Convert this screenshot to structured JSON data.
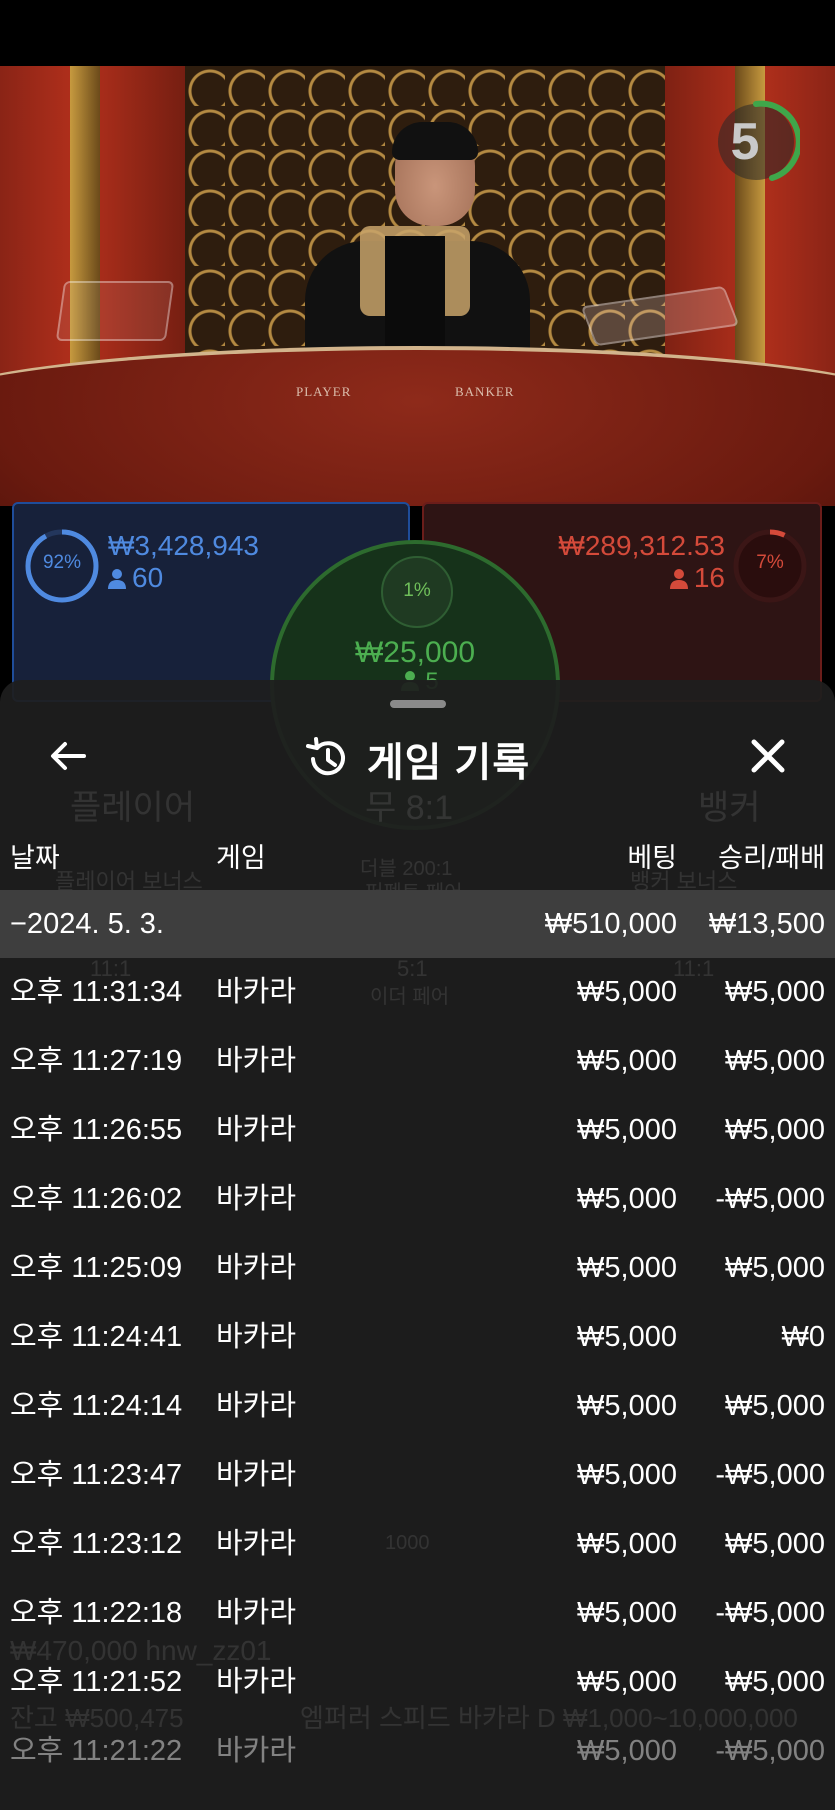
{
  "video": {
    "felt_labels": [
      "PLAYER",
      "BANKER"
    ],
    "timer": "5"
  },
  "bets": {
    "player": {
      "percent": "92%",
      "amount": "₩3,428,943",
      "count": "60"
    },
    "tie": {
      "percent": "1%",
      "amount": "₩25,000",
      "count": "5"
    },
    "banker": {
      "percent": "7%",
      "amount": "₩289,312.53",
      "count": "16"
    }
  },
  "background_ghost_text": {
    "player_label": "플레이어",
    "tie_label": "무 8:1",
    "banker_label": "뱅커",
    "player_bonus": "플레이어 보너스",
    "perfect_pair": "퍼펙트 페어",
    "either_pair": "이더 페어",
    "banker_bonus": "뱅커 보너스",
    "odds_200": "더블 200:1",
    "odds_5": "5:1",
    "odds_11a": "11:1",
    "odds_11b": "11:1",
    "user_line": "₩470,000 hnw_zz01",
    "balance_line": "잔고 ₩500,475",
    "table_line": "엠퍼러 스피드 바카라 D  ₩1,000~10,000,000",
    "chip": "1000"
  },
  "sheet": {
    "title": "게임 기록",
    "back_icon": "arrow-left-icon",
    "history_icon": "history-icon",
    "close_icon": "close-icon",
    "columns": {
      "date": "날짜",
      "game": "게임",
      "bet": "베팅",
      "result": "승리/패배"
    },
    "summary": {
      "date": "−2024. 5. 3.",
      "bet": "₩510,000",
      "result": "₩13,500"
    },
    "rows": [
      {
        "time": "오후 11:31:34",
        "game": "바카라",
        "bet": "₩5,000",
        "result": "₩5,000"
      },
      {
        "time": "오후 11:27:19",
        "game": "바카라",
        "bet": "₩5,000",
        "result": "₩5,000"
      },
      {
        "time": "오후 11:26:55",
        "game": "바카라",
        "bet": "₩5,000",
        "result": "₩5,000"
      },
      {
        "time": "오후 11:26:02",
        "game": "바카라",
        "bet": "₩5,000",
        "result": "-₩5,000"
      },
      {
        "time": "오후 11:25:09",
        "game": "바카라",
        "bet": "₩5,000",
        "result": "₩5,000"
      },
      {
        "time": "오후 11:24:41",
        "game": "바카라",
        "bet": "₩5,000",
        "result": "₩0"
      },
      {
        "time": "오후 11:24:14",
        "game": "바카라",
        "bet": "₩5,000",
        "result": "₩5,000"
      },
      {
        "time": "오후 11:23:47",
        "game": "바카라",
        "bet": "₩5,000",
        "result": "-₩5,000"
      },
      {
        "time": "오후 11:23:12",
        "game": "바카라",
        "bet": "₩5,000",
        "result": "₩5,000"
      },
      {
        "time": "오후 11:22:18",
        "game": "바카라",
        "bet": "₩5,000",
        "result": "-₩5,000"
      },
      {
        "time": "오후 11:21:52",
        "game": "바카라",
        "bet": "₩5,000",
        "result": "₩5,000"
      },
      {
        "time": "오후 11:21:22",
        "game": "바카라",
        "bet": "₩5,000",
        "result": "-₩5,000"
      }
    ]
  },
  "colors": {
    "player_blue": "#4f8ae0",
    "banker_red": "#d44a3a",
    "tie_green": "#4caf50",
    "timer_green": "#3fa64a",
    "sheet_bg": "#1e1e1e",
    "summary_bg": "#3e3e3e"
  }
}
